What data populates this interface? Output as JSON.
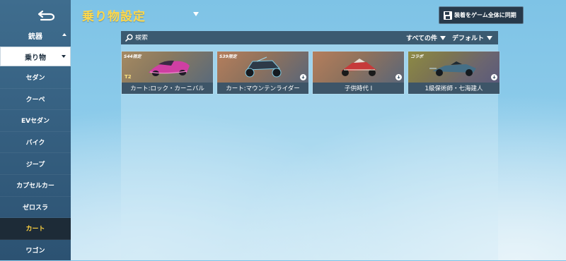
{
  "title": "乗り物設定",
  "sync_button": {
    "label": "装着をゲーム全体に同期"
  },
  "sidebar": {
    "header": "銃器",
    "selected": "乗り物",
    "items": [
      {
        "label": "セダン"
      },
      {
        "label": "クーペ"
      },
      {
        "label": "EVセダン"
      },
      {
        "label": "バイク"
      },
      {
        "label": "ジープ"
      },
      {
        "label": "カプセルカー"
      },
      {
        "label": "ゼロスラ"
      },
      {
        "label": "カート",
        "active": true
      },
      {
        "label": "ワゴン"
      }
    ]
  },
  "toolbar": {
    "search_placeholder": "検索",
    "filter_all": "すべての件",
    "sort_default": "デフォルト"
  },
  "cards": [
    {
      "name": "カート:ロック・カーニバル",
      "tag": "S44限定",
      "rank": "T2",
      "color": "#c84aa0"
    },
    {
      "name": "カート:マウンテンライダー",
      "tag": "S39限定",
      "rank": "",
      "color": "#6fb0c8"
    },
    {
      "name": "子供時代 I",
      "tag": "",
      "rank": "",
      "color": "#cc3b3b"
    },
    {
      "name": "1級保術師・七海建人",
      "tag": "コラボ",
      "rank": "",
      "color": "#4a7890"
    }
  ],
  "colors": {
    "title": "#ffd84a",
    "active_sidebar_text": "#ffd23f",
    "panel_bar": "#3b5a70"
  }
}
